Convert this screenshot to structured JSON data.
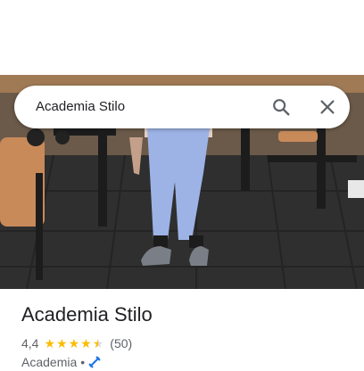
{
  "search": {
    "query": "Academia Stilo"
  },
  "place": {
    "name": "Academia Stilo",
    "rating": "4,4",
    "rating_value": 4.4,
    "reviews": "(50)",
    "category": "Academia",
    "separator": "•"
  },
  "colors": {
    "star": "#fbbc04",
    "icon_blue": "#1a73e8",
    "text_secondary": "#5f6368"
  }
}
